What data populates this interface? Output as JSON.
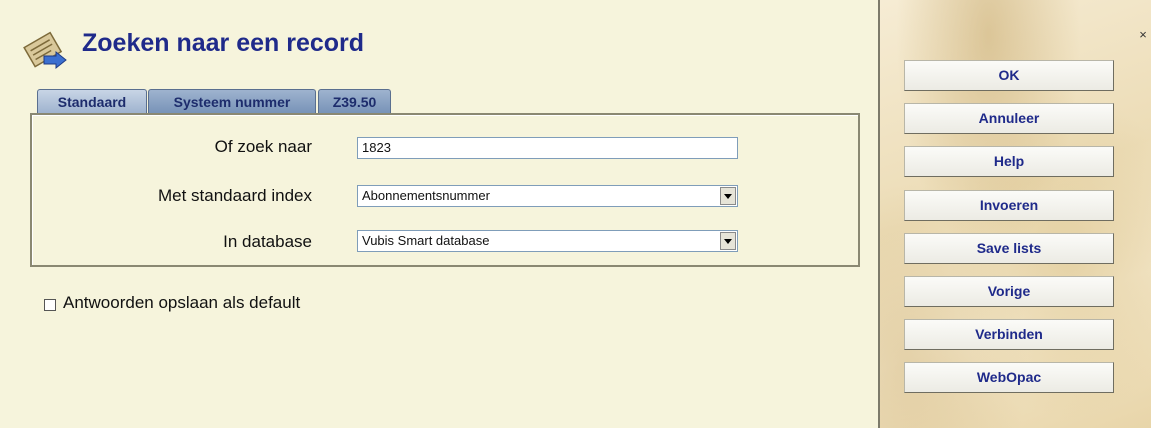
{
  "dialog": {
    "title": "Zoeken naar een record",
    "title_icon": "search-records-icon"
  },
  "tabs": [
    {
      "label": "Standaard",
      "active": true
    },
    {
      "label": "Systeem nummer",
      "active": false
    },
    {
      "label": "Z39.50",
      "active": false
    }
  ],
  "form": {
    "search_label": "Of zoek naar",
    "search_value": "1823",
    "index_label": "Met standaard index",
    "index_value": "Abonnementsnummer",
    "database_label": "In database",
    "database_value": "Vubis Smart database"
  },
  "save_default": {
    "label": "Antwoorden opslaan als default",
    "checked": false
  },
  "buttons": {
    "ok": "OK",
    "cancel": "Annuleer",
    "help": "Help",
    "enter": "Invoeren",
    "save_lists": "Save lists",
    "previous": "Vorige",
    "connect": "Verbinden",
    "webopac": "WebOpac"
  },
  "close_symbol": "×",
  "colors": {
    "title": "#1f2a8a",
    "background": "#f6f4dc",
    "tab": "#8fa6c6",
    "button_text": "#1f2a8a"
  }
}
